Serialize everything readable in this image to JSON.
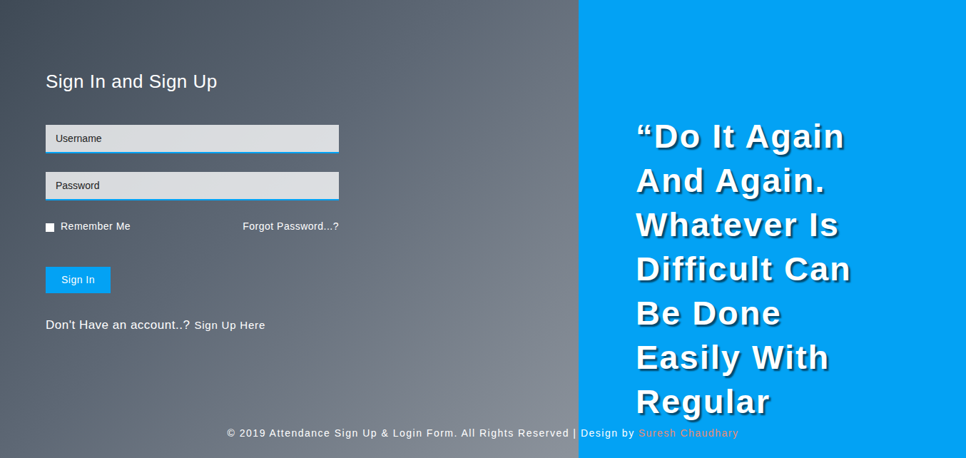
{
  "heading": "Sign In and Sign Up",
  "form": {
    "username": {
      "placeholder": "Username"
    },
    "password": {
      "placeholder": "Password"
    },
    "remember": {
      "label": "Remember Me",
      "checked": false
    },
    "forgot": "Forgot Password...?",
    "submit": "Sign In",
    "signup": {
      "prompt": "Don't Have an account..?",
      "link": "Sign Up Here"
    }
  },
  "quote": "“Do It Again And Again. Whatever Is Difficult Can Be Done Easily With Regular",
  "footer": {
    "text": "© 2019 Attendance Sign Up & Login Form. All Rights Reserved | Design by",
    "author": "Suresh Chaudhary"
  }
}
